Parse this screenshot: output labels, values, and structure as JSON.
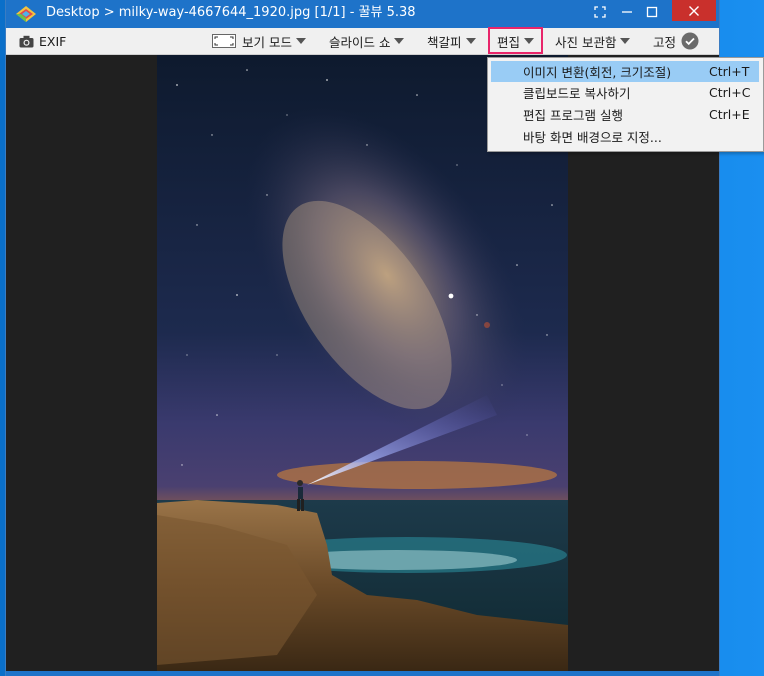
{
  "window": {
    "title": "Desktop > milky-way-4667644_1920.jpg [1/1] - 꿀뷰 5.38",
    "controls": {
      "close": "✕",
      "maximize": "☐",
      "minimize": "—",
      "fullscreen": "⛶"
    }
  },
  "toolbar": {
    "exif_label": "EXIF",
    "view_mode_label": "보기 모드",
    "slideshow_label": "슬라이드 쇼",
    "bookmark_label": "책갈피",
    "edit_label": "편집",
    "photo_archive_label": "사진 보관함",
    "pin_label": "고정"
  },
  "edit_menu": {
    "items": [
      {
        "label": "이미지 변환(회전, 크기조절)",
        "shortcut": "Ctrl+T",
        "selected": true
      },
      {
        "label": "클립보드로 복사하기",
        "shortcut": "Ctrl+C",
        "selected": false
      },
      {
        "label": "편집 프로그램 실행",
        "shortcut": "Ctrl+E",
        "selected": false
      },
      {
        "label": "바탕 화면 배경으로 지정...",
        "shortcut": "",
        "selected": false
      }
    ]
  },
  "colors": {
    "title_bar": "#1e73c9",
    "close_button": "#c9302c",
    "highlight": "#e8256a",
    "menu_selection": "#99ccf5"
  },
  "icons": [
    "app-logo-icon",
    "camera-icon",
    "view-mode-icon",
    "check-circle-icon",
    "fullscreen-icon",
    "minimize-icon",
    "maximize-icon",
    "close-icon",
    "chevron-down-icon"
  ]
}
